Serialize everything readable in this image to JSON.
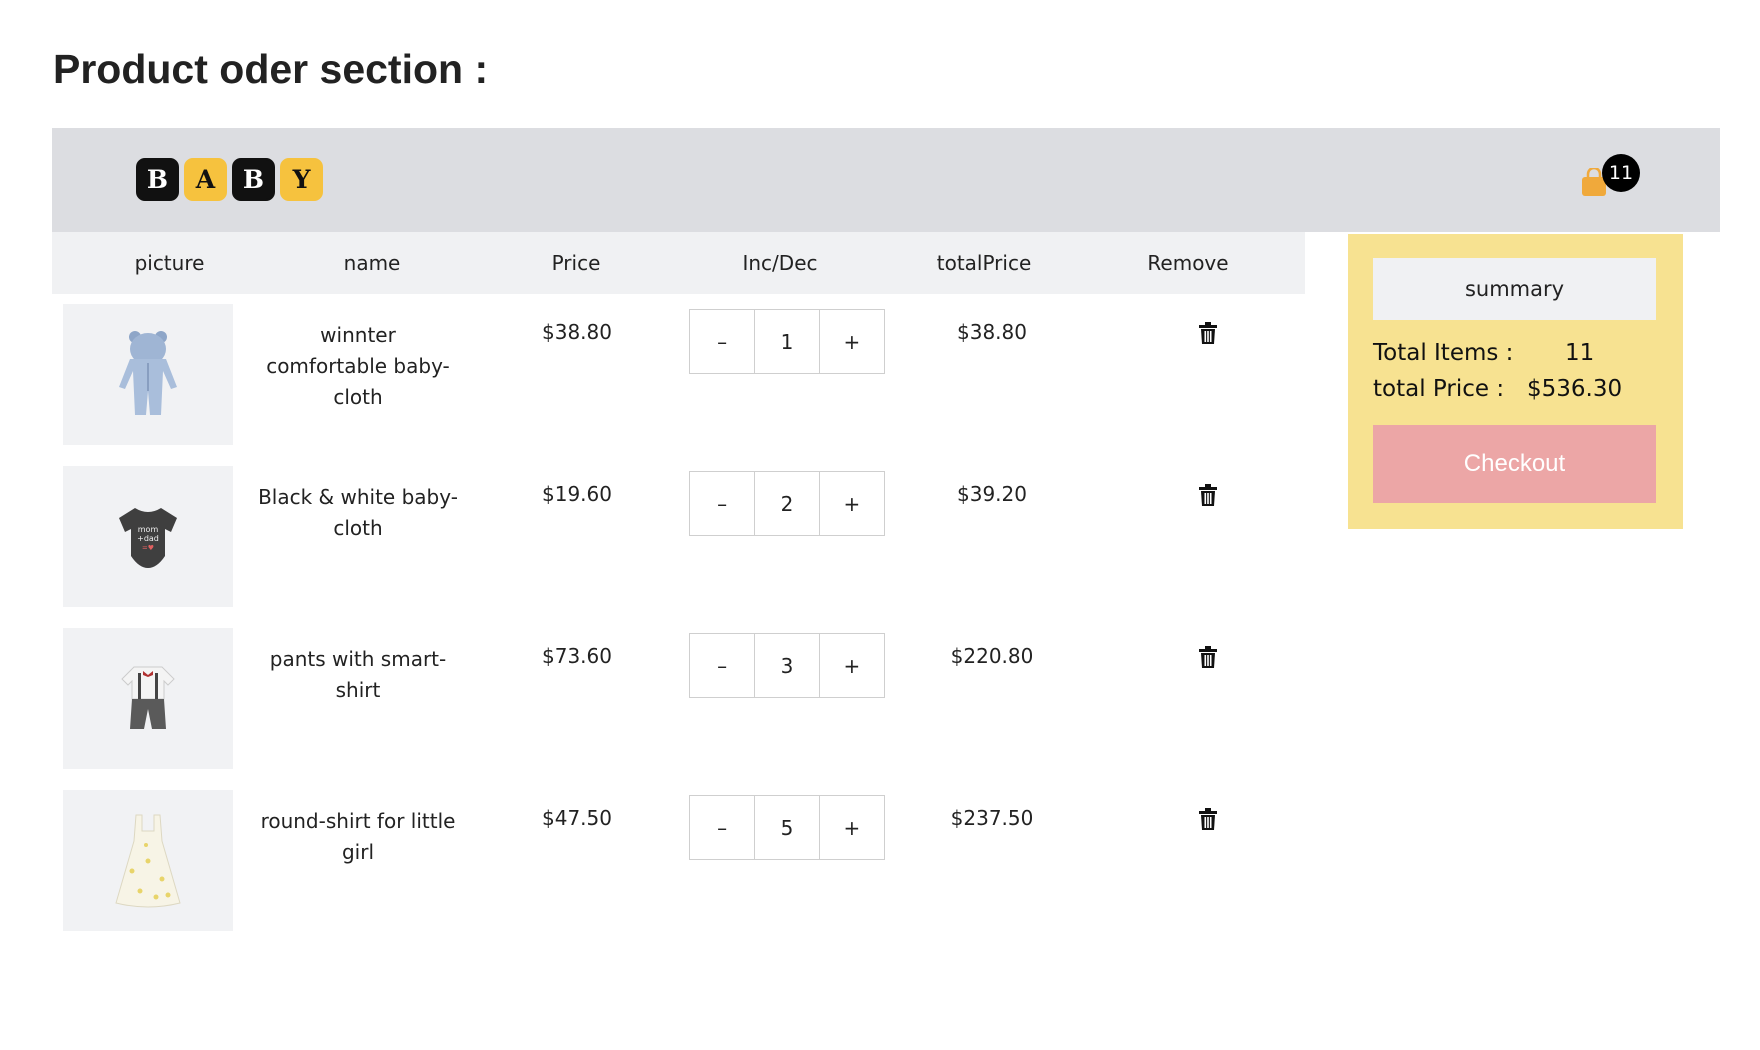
{
  "page": {
    "title": "Product oder section :"
  },
  "navbar": {
    "logo_letters": [
      "B",
      "A",
      "B",
      "Y"
    ],
    "cart": {
      "icon": "shopping-bag-icon",
      "count": "11",
      "color": "#f0a93b"
    }
  },
  "table": {
    "headers": {
      "picture": "picture",
      "name": "name",
      "price": "Price",
      "incdec": "Inc/Dec",
      "total": "totalPrice",
      "remove": "Remove"
    },
    "rows": [
      {
        "image": "blue-hooded-romper",
        "name": "winnter comfortable baby-cloth",
        "price": "$38.80",
        "qty": "1",
        "total": "$38.80",
        "minus": "–",
        "plus": "+"
      },
      {
        "image": "black-onesie",
        "name": "Black & white baby-cloth",
        "price": "$19.60",
        "qty": "2",
        "total": "$39.20",
        "minus": "–",
        "plus": "+"
      },
      {
        "image": "shirt-with-pants",
        "name": "pants with smart-shirt",
        "price": "$73.60",
        "qty": "3",
        "total": "$220.80",
        "minus": "–",
        "plus": "+"
      },
      {
        "image": "white-dress",
        "name": "round-shirt for little girl",
        "price": "$47.50",
        "qty": "5",
        "total": "$237.50",
        "minus": "–",
        "plus": "+"
      }
    ]
  },
  "summary": {
    "heading": "summary",
    "total_items_label": "Total Items :",
    "total_items_value": "11",
    "total_price_label": "total Price :",
    "total_price_value": "$536.30",
    "checkout_label": "Checkout"
  },
  "colors": {
    "navbar": "#dcdde1",
    "summary_bg": "#f7e291",
    "checkout": "#eca6a6",
    "logo_yellow": "#f6c23e"
  }
}
